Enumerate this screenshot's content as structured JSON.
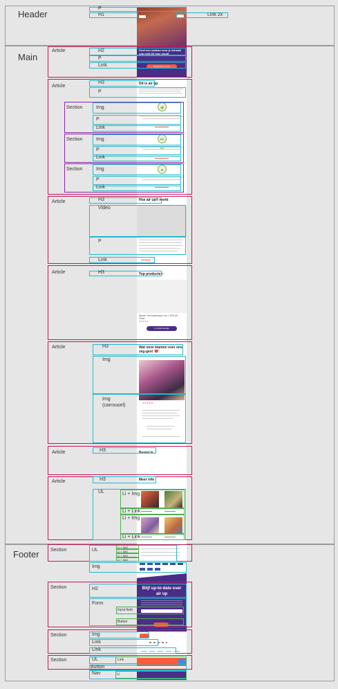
{
  "regions": {
    "header": "Header",
    "main": "Main",
    "footer": "Footer"
  },
  "labels": {
    "p": "P",
    "h1": "H1",
    "h2": "H2",
    "h3": "H3",
    "link": "Link",
    "link2x": "Link 2x",
    "article": "Article",
    "section": "Section",
    "img": "Img",
    "video": "Video",
    "img_carousel": "Img\n(carrousel)",
    "ul": "UL",
    "li_img": "Li + Img",
    "li_link": "Li + Link",
    "li_img_caps": "Li + IMG",
    "form": "Form",
    "input_field": "Input field",
    "button": "Button",
    "button_title": "Button",
    "nav": "Nav",
    "li": "Li"
  },
  "phone": {
    "hero_heading": "Geef een cadeau voor je Airmatt ook echt bij mee mooit",
    "hero_button": "Bestel het nu voor",
    "air_up_title": "Dit is air up",
    "how_title": "Hoe air up® werkt",
    "top_title": "Top producten",
    "product_name": "Starter Set Arabesque Jus + Flask",
    "product_price": "€33,99",
    "product_cta": "In winkelmandje",
    "reviews_title": "Wat onze klanten over ons zeg-gen! ❤️",
    "stars": "★★★★★",
    "shop_in_title": "Bestel in",
    "more_info_title": "Meer info",
    "newsletter_title": "Blijf up-to-date over air up",
    "badges": [
      "🌿",
      "BPA free",
      "♻"
    ]
  },
  "colors": {
    "article": "#c2185b",
    "section": "#8e24aa",
    "element": "#22b8cf",
    "list_item": "#4caf50",
    "brand_purple": "#4a2d87",
    "brand_orange": "#ff5a3c"
  }
}
